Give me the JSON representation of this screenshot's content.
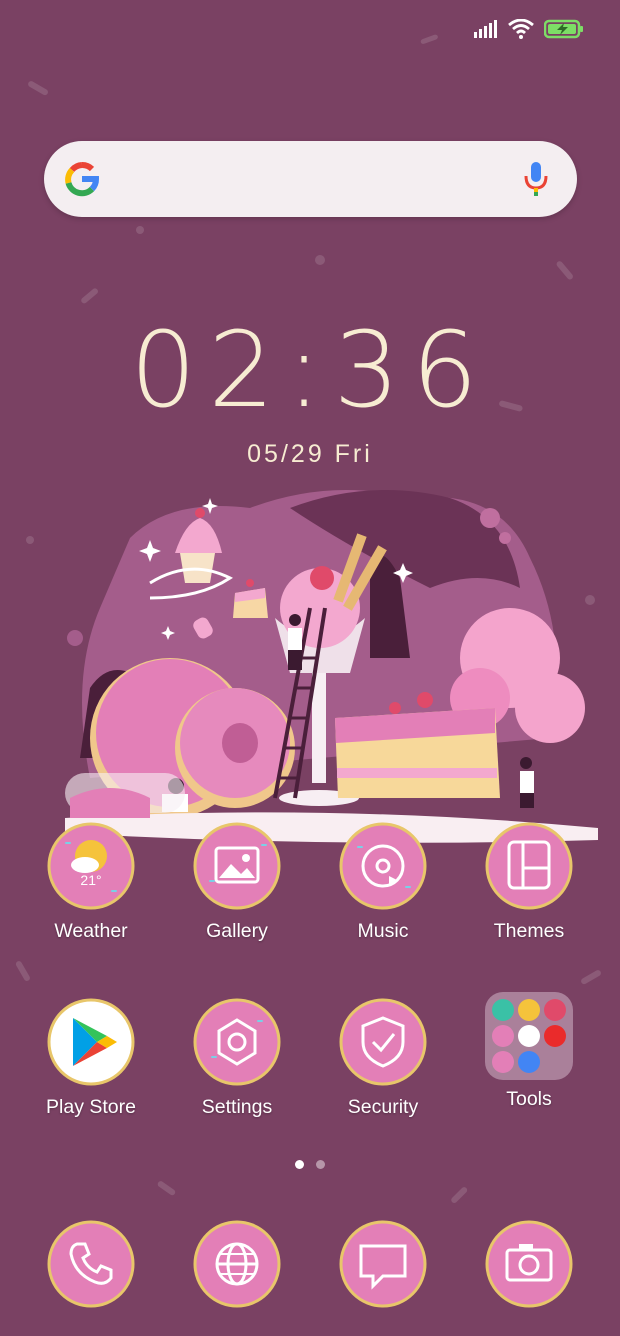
{
  "status": {
    "signal": "signal-icon",
    "wifi": "wifi-icon",
    "battery": "battery-charging-icon"
  },
  "search": {
    "logo": "google-logo",
    "mic": "mic-icon"
  },
  "clock": {
    "time": "02:36",
    "date": "05/29  Fri"
  },
  "apps_row1": [
    {
      "label": "Weather",
      "icon": "weather-icon",
      "temp": "21°"
    },
    {
      "label": "Gallery",
      "icon": "gallery-icon"
    },
    {
      "label": "Music",
      "icon": "music-icon"
    },
    {
      "label": "Themes",
      "icon": "themes-icon"
    }
  ],
  "apps_row2": [
    {
      "label": "Play Store",
      "icon": "play-store-icon"
    },
    {
      "label": "Settings",
      "icon": "settings-icon"
    },
    {
      "label": "Security",
      "icon": "security-icon"
    },
    {
      "label": "Tools",
      "icon": "folder-icon"
    }
  ],
  "dock": [
    {
      "icon": "phone-icon"
    },
    {
      "icon": "browser-icon"
    },
    {
      "icon": "messages-icon"
    },
    {
      "icon": "camera-icon"
    }
  ],
  "page_indicator": {
    "pages": 2,
    "current": 1
  },
  "colors": {
    "background": "#7a4163",
    "donut": "#e37fb7",
    "frosting": "#d86aa9",
    "ring": "#e8c66a"
  }
}
